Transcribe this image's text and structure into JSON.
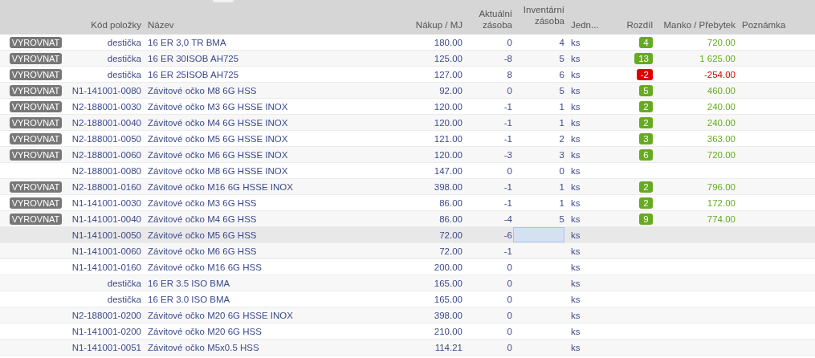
{
  "table": {
    "columns": [
      {
        "label": "Kód položky"
      },
      {
        "label": "Název"
      },
      {
        "label": "Nákup / MJ"
      },
      {
        "label": "Aktuální zásoba"
      },
      {
        "label": "Inventární zásoba"
      },
      {
        "label": "Jedn..."
      },
      {
        "label": "Rozdíl"
      },
      {
        "label": "Manko / Přebytek"
      },
      {
        "label": "Poznámka"
      }
    ],
    "rows": [
      {
        "button": "VYROVNAT",
        "code": "destička",
        "name": "16 ER 3,0 TR BMA",
        "price": "180.00",
        "current": "0",
        "inventory": "4",
        "unit": "ks",
        "diff": "4",
        "amount": "720.00",
        "color": "#66aa22",
        "selected": false
      },
      {
        "button": "VYROVNAT",
        "code": "destička",
        "name": "16 ER 30ISOB AH725",
        "price": "125.00",
        "current": "-8",
        "inventory": "5",
        "unit": "ks",
        "diff": "13",
        "amount": "1 625.00",
        "color": "#66aa22",
        "selected": false
      },
      {
        "button": "VYROVNAT",
        "code": "destička",
        "name": "16 ER 25ISOB AH725",
        "price": "127.00",
        "current": "8",
        "inventory": "6",
        "unit": "ks",
        "diff": "-2",
        "amount": "-254.00",
        "color": "#dd0000",
        "selected": false
      },
      {
        "button": "VYROVNAT",
        "code": "N1-141001-0080",
        "name": "Závitové očko M8  6G HSS",
        "price": "92.00",
        "current": "0",
        "inventory": "5",
        "unit": "ks",
        "diff": "5",
        "amount": "460.00",
        "color": "#66aa22",
        "selected": false
      },
      {
        "button": "VYROVNAT",
        "code": "N2-188001-0030",
        "name": "Závitové očko M3 6G HSSE INOX",
        "price": "120.00",
        "current": "-1",
        "inventory": "1",
        "unit": "ks",
        "diff": "2",
        "amount": "240.00",
        "color": "#66aa22",
        "selected": false
      },
      {
        "button": "VYROVNAT",
        "code": "N2-188001-0040",
        "name": "Závitové očko M4 6G HSSE INOX",
        "price": "120.00",
        "current": "-1",
        "inventory": "1",
        "unit": "ks",
        "diff": "2",
        "amount": "240.00",
        "color": "#66aa22",
        "selected": false
      },
      {
        "button": "VYROVNAT",
        "code": "N2-188001-0050",
        "name": "Závitové očko M5 6G HSSE INOX",
        "price": "121.00",
        "current": "-1",
        "inventory": "2",
        "unit": "ks",
        "diff": "3",
        "amount": "363.00",
        "color": "#66aa22",
        "selected": false
      },
      {
        "button": "VYROVNAT",
        "code": "N2-188001-0060",
        "name": "Závitové očko M6 6G HSSE INOX",
        "price": "120.00",
        "current": "-3",
        "inventory": "3",
        "unit": "ks",
        "diff": "6",
        "amount": "720.00",
        "color": "#66aa22",
        "selected": false
      },
      {
        "code": "N2-188001-0080",
        "name": "Závitové očko M8 6G HSSE INOX",
        "price": "147.00",
        "current": "0",
        "inventory": "0",
        "unit": "ks",
        "selected": false
      },
      {
        "button": "VYROVNAT",
        "code": "N2-188001-0160",
        "name": "Závitové očko M16 6G HSSE INOX",
        "price": "398.00",
        "current": "-1",
        "inventory": "1",
        "unit": "ks",
        "diff": "2",
        "amount": "796.00",
        "color": "#66aa22",
        "selected": false
      },
      {
        "button": "VYROVNAT",
        "code": "N1-141001-0030",
        "name": "Závitové očko M3 6G HSS",
        "price": "86.00",
        "current": "-1",
        "inventory": "1",
        "unit": "ks",
        "diff": "2",
        "amount": "172.00",
        "color": "#66aa22",
        "selected": false
      },
      {
        "button": "VYROVNAT",
        "code": "N1-141001-0040",
        "name": "Závitové očko M4 6G HSS",
        "price": "86.00",
        "current": "-4",
        "inventory": "5",
        "unit": "ks",
        "diff": "9",
        "amount": "774.00",
        "color": "#66aa22",
        "selected": false
      },
      {
        "code": "N1-141001-0050",
        "name": "Závitové očko M5 6G HSS",
        "price": "72.00",
        "current": "-6",
        "unit": "ks",
        "selected": true
      },
      {
        "code": "N1-141001-0060",
        "name": "Závitové očko M6 6G HSS",
        "price": "72.00",
        "current": "-1",
        "unit": "ks",
        "selected": false
      },
      {
        "code": "N1-141001-0160",
        "name": "Závitové očko M16  6G HSS",
        "price": "200.00",
        "current": "0",
        "unit": "ks",
        "selected": false
      },
      {
        "code": "destička",
        "name": "16 ER 3.5 ISO BMA",
        "price": "165.00",
        "current": "0",
        "unit": "ks",
        "selected": false
      },
      {
        "code": "destička",
        "name": "16 ER 3.0 ISO BMA",
        "price": "165.00",
        "current": "0",
        "unit": "ks",
        "selected": false
      },
      {
        "code": "N2-188001-0200",
        "name": "Závitové očko M20 6G HSSE INOX",
        "price": "398.00",
        "current": "0",
        "unit": "ks",
        "selected": false
      },
      {
        "code": "N1-141001-0200",
        "name": "Závitové očko M20  6G HSS",
        "price": "210.00",
        "current": "0",
        "unit": "ks",
        "selected": false
      },
      {
        "code": "N1-141001-0051",
        "name": "Závitové očko M5x0.5 HSS",
        "price": "114.21",
        "current": "0",
        "unit": "ks",
        "selected": false
      }
    ]
  }
}
